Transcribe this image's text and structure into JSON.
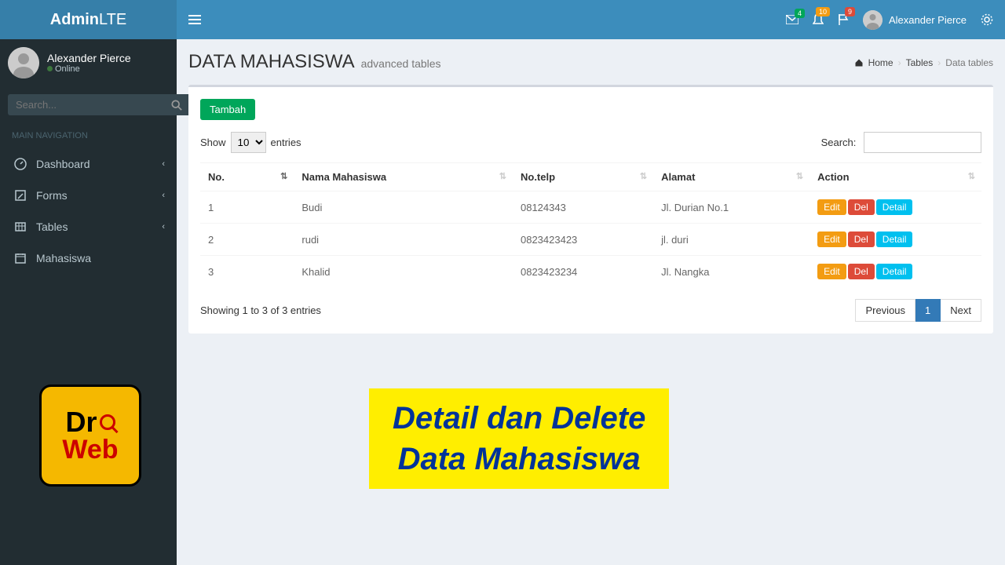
{
  "brand": {
    "a": "Admin",
    "b": "LTE"
  },
  "user": {
    "name": "Alexander Pierce",
    "status": "Online"
  },
  "search_placeholder": "Search...",
  "nav_header": "MAIN NAVIGATION",
  "nav": [
    {
      "label": "Dashboard",
      "hasChev": true
    },
    {
      "label": "Forms",
      "hasChev": true
    },
    {
      "label": "Tables",
      "hasChev": true
    },
    {
      "label": "Mahasiswa",
      "hasChev": false
    }
  ],
  "top_badges": {
    "mail": "4",
    "bell": "10",
    "flag": "9"
  },
  "top_user": "Alexander Pierce",
  "page": {
    "title": "DATA MAHASISWA",
    "subtitle": "advanced tables"
  },
  "breadcrumb": {
    "home": "Home",
    "mid": "Tables",
    "last": "Data tables"
  },
  "add_btn": "Tambah",
  "dt": {
    "show": "Show",
    "entries": "entries",
    "entries_val": "10",
    "search": "Search:",
    "info": "Showing 1 to 3 of 3 entries",
    "prev": "Previous",
    "next": "Next",
    "page": "1"
  },
  "cols": {
    "no": "No.",
    "nama": "Nama Mahasiswa",
    "telp": "No.telp",
    "alamat": "Alamat",
    "action": "Action"
  },
  "rows": [
    {
      "no": "1",
      "nama": "Budi",
      "telp": "08124343",
      "alamat": "Jl. Durian No.1"
    },
    {
      "no": "2",
      "nama": "rudi",
      "telp": "0823423423",
      "alamat": "jl. duri"
    },
    {
      "no": "3",
      "nama": "Khalid",
      "telp": "0823423234",
      "alamat": "Jl. Nangka"
    }
  ],
  "actions": {
    "edit": "Edit",
    "del": "Del",
    "detail": "Detail"
  },
  "banner": {
    "line1": "Detail dan Delete",
    "line2": "Data Mahasiswa"
  },
  "drweb": {
    "dr": "Dr",
    "web": "Web"
  }
}
